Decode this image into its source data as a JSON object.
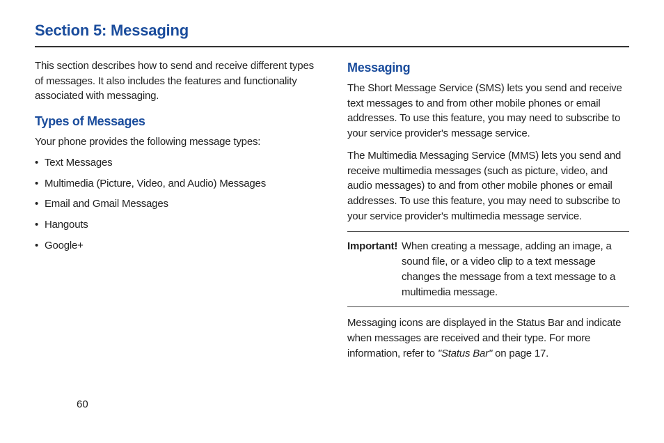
{
  "sectionTitle": "Section 5: Messaging",
  "pageNumber": "60",
  "left": {
    "intro": "This section describes how to send and receive different types of messages. It also includes the features and functionality associated with messaging.",
    "heading1": "Types of Messages",
    "leadIn": "Your phone provides the following message types:",
    "bullets": [
      "Text Messages",
      "Multimedia (Picture, Video, and Audio) Messages",
      "Email and Gmail Messages",
      "Hangouts",
      "Google+"
    ]
  },
  "right": {
    "heading": "Messaging",
    "para1": "The Short Message Service (SMS) lets you send and receive text messages to and from other mobile phones or email addresses. To use this feature, you may need to subscribe to your service provider's message service.",
    "para2": "The Multimedia Messaging Service (MMS) lets you send and receive multimedia messages (such as picture, video, and audio messages) to and from other mobile phones or email addresses. To use this feature, you may need to subscribe to your service provider's multimedia message service.",
    "importantLabel": "Important! ",
    "importantBody": "When creating a message, adding an image, a sound file, or a video clip to a text message changes the message from a text message to a multimedia message.",
    "refPart1": "Messaging icons are displayed in the Status Bar and indicate when messages are received and their type. For more information, refer to ",
    "refItalic": "\"Status Bar\"",
    "refPart2": " on page 17."
  }
}
